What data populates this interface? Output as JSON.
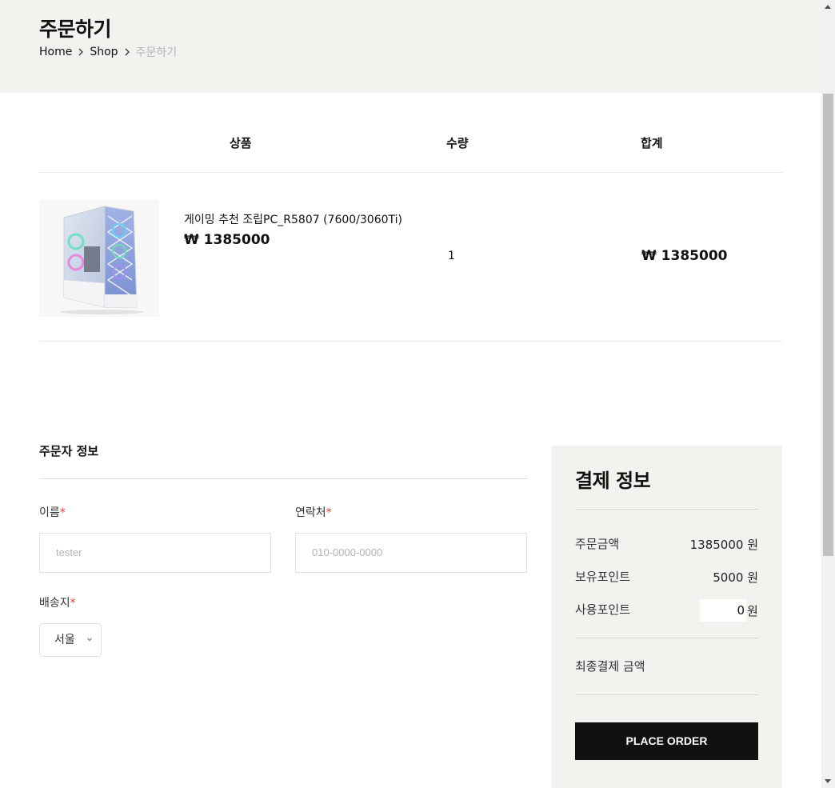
{
  "header": {
    "title": "주문하기",
    "breadcrumb": [
      "Home",
      "Shop",
      "주문하기"
    ]
  },
  "cart": {
    "columns": [
      "상품",
      "수량",
      "합계"
    ],
    "items": [
      {
        "name": "게이밍 추천 조립PC_R5807 (7600/3060Ti)",
        "price": "₩ 1385000",
        "quantity": "1",
        "total": "₩ 1385000",
        "image": "gaming-pc-case-white"
      }
    ]
  },
  "orderer": {
    "title": "주문자 정보",
    "name_label": "이름",
    "name_placeholder": "tester",
    "phone_label": "연락처",
    "phone_placeholder": "010-0000-0000",
    "address_label": "배송지",
    "address_selected": "서울",
    "required_mark": "*"
  },
  "payment": {
    "title": "결제 정보",
    "order_amount_label": "주문금액",
    "order_amount": "1385000 원",
    "owned_points_label": "보유포인트",
    "owned_points": "5000 원",
    "use_points_label": "사용포인트",
    "use_points_value": "0",
    "use_points_unit": "원",
    "final_label": "최종결제 금액",
    "place_order": "PLACE ORDER"
  },
  "colors": {
    "hero_bg": "#f3f2ee",
    "required": "#e23d3d",
    "button": "#111111"
  }
}
